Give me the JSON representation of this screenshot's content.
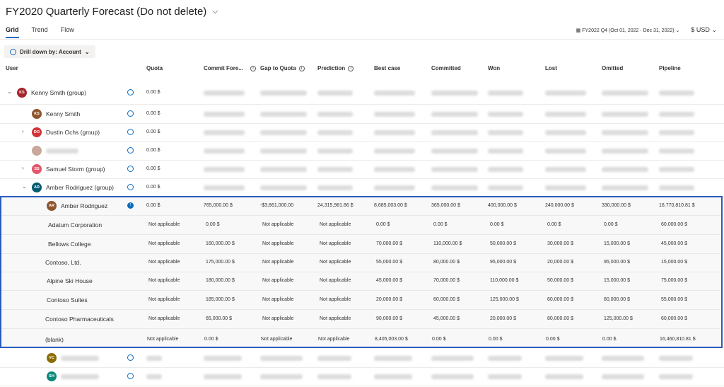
{
  "header": {
    "title": "FY2020 Quarterly Forecast (Do not delete)",
    "tabs": [
      "Grid",
      "Trend",
      "Flow"
    ],
    "period": "FY2022 Q4 (Oct 01, 2022 - Dec 31, 2022)",
    "currency": "$ USD"
  },
  "toolbar": {
    "drill_label": "Drill down by: Account"
  },
  "columns": {
    "user": "User",
    "quota": "Quota",
    "commit": "Commit Fore...",
    "gap": "Gap to Quota",
    "prediction": "Prediction",
    "best": "Best case",
    "committed": "Committed",
    "won": "Won",
    "lost": "Lost",
    "omitted": "Omitted",
    "pipeline": "Pipeline"
  },
  "rows": [
    {
      "initials": "KS",
      "name": "Kenny Smith (group)",
      "quota": "0.00 $",
      "color": "#a4262c"
    },
    {
      "initials": "KS",
      "name": "Kenny Smith",
      "quota": "0.00 $",
      "color": "#8e562e"
    },
    {
      "initials": "DO",
      "name": "Dustin Ochs (group)",
      "quota": "0.00 $",
      "color": "#d13438"
    },
    {
      "initials": "",
      "name": "",
      "quota": "0.00 $",
      "color": "#c8a89a"
    },
    {
      "initials": "SS",
      "name": "Samuel Storm (group)",
      "quota": "0.00 $",
      "color": "#e3566b"
    },
    {
      "initials": "AR",
      "name": "Amber Rodriguez (group)",
      "quota": "0.00 $",
      "color": "#005b70"
    }
  ],
  "highlight": {
    "user": {
      "initials": "AR",
      "name": "Amber Rodriguez",
      "color": "#8e562e",
      "values": [
        "0.00 $",
        "765,000.00 $",
        "-$3,861,000.00",
        "24,315,981.86 $",
        "8,685,003.00 $",
        "365,000.00 $",
        "400,000.00 $",
        "240,000.00 $",
        "330,000.00 $",
        "16,770,810.81 $"
      ]
    },
    "accounts": [
      {
        "name": "Adatum Corporation",
        "values": [
          "Not applicable",
          "0.00 $",
          "Not applicable",
          "Not applicable",
          "0.00 $",
          "0.00 $",
          "0.00 $",
          "0.00 $",
          "0.00 $",
          "60,000.00 $"
        ]
      },
      {
        "name": "Bellows College",
        "values": [
          "Not applicable",
          "160,000.00 $",
          "Not applicable",
          "Not applicable",
          "70,000.00 $",
          "110,000.00 $",
          "50,000.00 $",
          "30,000.00 $",
          "15,000.00 $",
          "45,000.00 $"
        ]
      },
      {
        "name": "Contoso, Ltd.",
        "values": [
          "Not applicable",
          "175,000.00 $",
          "Not applicable",
          "Not applicable",
          "55,000.00 $",
          "80,000.00 $",
          "95,000.00 $",
          "20,000.00 $",
          "95,000.00 $",
          "15,000.00 $"
        ]
      },
      {
        "name": "Alpine Ski House",
        "values": [
          "Not applicable",
          "180,000.00 $",
          "Not applicable",
          "Not applicable",
          "45,000.00 $",
          "70,000.00 $",
          "110,000.00 $",
          "50,000.00 $",
          "15,000.00 $",
          "75,000.00 $"
        ]
      },
      {
        "name": "Contoso Suites",
        "values": [
          "Not applicable",
          "185,000.00 $",
          "Not applicable",
          "Not applicable",
          "20,000.00 $",
          "60,000.00 $",
          "125,000.00 $",
          "60,000.00 $",
          "80,000.00 $",
          "55,000.00 $"
        ]
      },
      {
        "name": "Contoso Pharmaceuticals",
        "values": [
          "Not applicable",
          "65,000.00 $",
          "Not applicable",
          "Not applicable",
          "90,000.00 $",
          "45,000.00 $",
          "20,000.00 $",
          "80,000.00 $",
          "125,000.00 $",
          "60,000.00 $"
        ]
      },
      {
        "name": "(blank)",
        "values": [
          "Not applicable",
          "0.00 $",
          "Not applicable",
          "Not applicable",
          "8,405,003.00 $",
          "0.00 $",
          "0.00 $",
          "0.00 $",
          "0.00 $",
          "16,460,810.81 $"
        ]
      }
    ]
  },
  "bottom_rows": [
    {
      "initials": "VC",
      "color": "#8c6c00"
    },
    {
      "initials": "SH",
      "color": "#0b8a7a"
    }
  ],
  "icons": [
    "chevron-down-icon",
    "chevron-right-icon",
    "hierarchy-icon",
    "info-icon"
  ]
}
